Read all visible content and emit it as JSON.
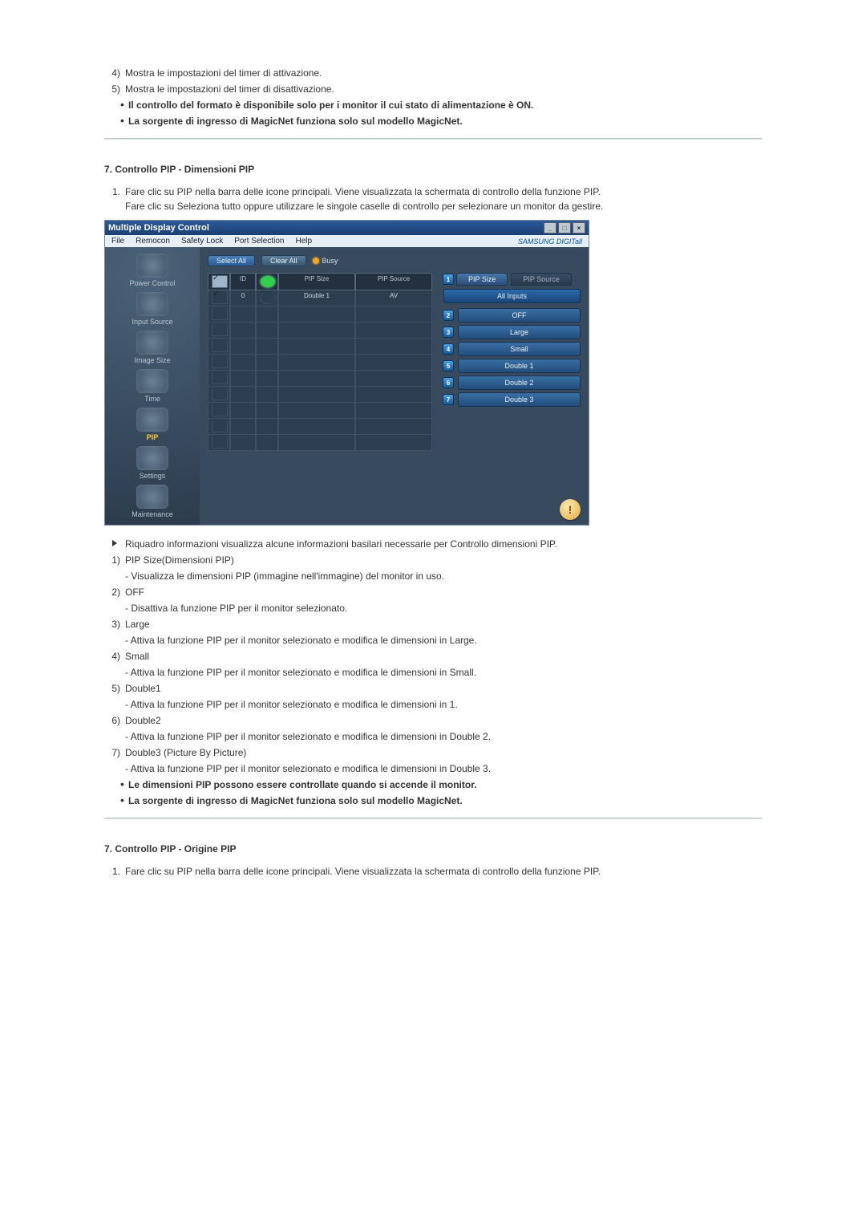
{
  "pre_list": [
    {
      "n": "4)",
      "text": "Mostra le impostazioni del timer di attivazione."
    },
    {
      "n": "5)",
      "text": "Mostra le impostazioni del timer di disattivazione."
    }
  ],
  "pre_bullets": [
    "Il controllo del formato è disponibile solo per i monitor il cui stato di alimentazione è ON.",
    "La sorgente di ingresso di MagicNet funziona solo sul modello MagicNet."
  ],
  "section1": {
    "title": "7. Controllo PIP - Dimensioni PIP",
    "intro_n": "1.",
    "intro_lines": [
      "Fare clic su PIP nella barra delle icone principali. Viene visualizzata la schermata di controllo della funzione PIP.",
      "Fare clic su Seleziona tutto oppure utilizzare le singole caselle di controllo per selezionare un monitor da gestire."
    ],
    "info_line": "Riquadro informazioni visualizza alcune informazioni basilari necessarie per Controllo dimensioni PIP.",
    "items": [
      {
        "n": "1)",
        "label": "PIP Size(Dimensioni PIP)",
        "sub": "- Visualizza le dimensioni PIP (immagine nell'immagine) del monitor in uso."
      },
      {
        "n": "2)",
        "label": "OFF",
        "sub": "- Disattiva la funzione PIP per il monitor selezionato."
      },
      {
        "n": "3)",
        "label": "Large",
        "sub": "- Attiva la funzione PIP per il monitor selezionato e modifica le dimensioni in Large."
      },
      {
        "n": "4)",
        "label": "Small",
        "sub": "- Attiva la funzione PIP per il monitor selezionato e modifica le dimensioni in Small."
      },
      {
        "n": "5)",
        "label": "Double1",
        "sub": "- Attiva la funzione PIP per il monitor selezionato e modifica le dimensioni in 1."
      },
      {
        "n": "6)",
        "label": "Double2",
        "sub": "- Attiva la funzione PIP per il monitor selezionato e modifica le dimensioni in Double 2."
      },
      {
        "n": "7)",
        "label": "Double3 (Picture By Picture)",
        "sub": "- Attiva la funzione PIP per il monitor selezionato e modifica le dimensioni in Double 3."
      }
    ],
    "end_bullets": [
      "Le dimensioni PIP possono essere controllate quando si accende il monitor.",
      "La sorgente di ingresso di MagicNet funziona solo sul modello MagicNet."
    ]
  },
  "section2": {
    "title": "7. Controllo PIP - Origine PIP",
    "intro_n": "1.",
    "intro_text": "Fare clic su PIP nella barra delle icone principali. Viene visualizzata la schermata di controllo della funzione PIP."
  },
  "shot": {
    "title": "Multiple Display Control",
    "menus": [
      "File",
      "Remocon",
      "Safety Lock",
      "Port Selection",
      "Help"
    ],
    "brand": "SAMSUNG DIGITall",
    "btn_select": "Select All",
    "btn_clear": "Clear All",
    "busy": "Busy",
    "sidebar": [
      "Power Control",
      "Input Source",
      "Image Size",
      "Time",
      "PIP",
      "Settings",
      "Maintenance"
    ],
    "sidebar_active_index": 4,
    "grid_headers": {
      "id": "ID",
      "size": "PIP Size",
      "src": "PIP Source"
    },
    "grid_row": {
      "id": "0",
      "size": "Double 1",
      "src": "AV"
    },
    "empty_rows": 9,
    "tab_active": "PIP Size",
    "tab_inactive": "PIP Source",
    "subheader": "All Inputs",
    "options": [
      {
        "num": "2",
        "label": "OFF"
      },
      {
        "num": "3",
        "label": "Large"
      },
      {
        "num": "4",
        "label": "Small"
      },
      {
        "num": "5",
        "label": "Double 1"
      },
      {
        "num": "6",
        "label": "Double 2"
      },
      {
        "num": "7",
        "label": "Double 3"
      }
    ],
    "tab_badge": "1",
    "hint": "!"
  }
}
